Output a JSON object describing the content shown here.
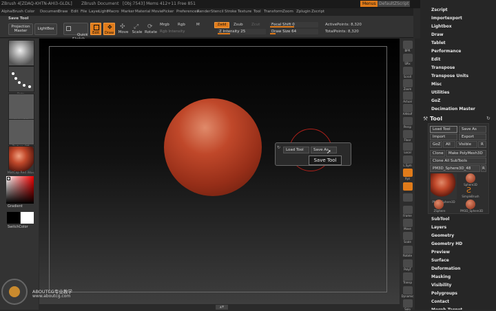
{
  "titlebar": {
    "app": "ZBrush 4[ZDAQ-KHTN-AHI3-GLDL]",
    "doc": "ZBrush Document",
    "stats": "[Obj:7543] Mems 412+11 Free 851",
    "menus_btn": "Menus",
    "script_btn": "DefaultZScript",
    "theme": "purpleicon"
  },
  "menubar": [
    "Alpha",
    "Brush",
    "Color",
    "Document",
    "Draw",
    "Edit",
    "File",
    "Layer",
    "Light",
    "Macro",
    "Marker",
    "Material",
    "Movie",
    "Picker",
    "Preferences",
    "Render",
    "Stencil",
    "Stroke",
    "Texture",
    "Tool",
    "Transform",
    "Zoom",
    "Zplugin",
    "Zscript"
  ],
  "toolbar": {
    "save_tool": "Save Tool",
    "projection_master": "Projection\nMaster",
    "lightbox": "LightBox",
    "quick_sketch": "Quick\nSketch",
    "edit": "Edit",
    "draw": "Draw",
    "move": "Move",
    "scale": "Scale",
    "rotate": "Rotate",
    "mrgb": "Mrgb",
    "rgb": "Rgb",
    "m": "M",
    "rgb_intensity": "Rgb Intensity",
    "zadd": "Zadd",
    "zsub": "Zsub",
    "zcut": "Zcut",
    "z_intensity": "Z Intensity 25",
    "focal_shift": "Focal Shift 0",
    "draw_size": "Draw Size 64",
    "active_points": "ActivePoints: 8,320",
    "total_points": "TotalPoints: 8,320"
  },
  "leftshelf": {
    "brush_cap": "Standard",
    "stroke_cap": "Dots",
    "alpha_cap": "Alpha Off",
    "texture_cap": "Texture Off",
    "material_cap": "MatCap Red Wax",
    "gradient": "Gradient",
    "switch_color": "SwitchColor"
  },
  "rightshelf": [
    "BPR",
    "SPix",
    "Scroll",
    "Zoom",
    "Actual",
    "AAHalf",
    "Persp",
    "Floor",
    "Local",
    "L.Sym",
    "Xyz",
    "",
    "",
    "Frame",
    "Move",
    "Scale",
    "Rotate",
    "PolyF",
    "Transp",
    "Dynamic",
    "Solo"
  ],
  "viewport_popup": {
    "load_tool": "Load Tool",
    "save_as": "Save As",
    "tooltip": "Save Tool"
  },
  "palette": {
    "top_items": [
      "Zscript",
      "Importexport",
      "Lightbox",
      "Draw",
      "Tablet",
      "Performance",
      "Edit",
      "Transpose",
      "Transpose Units",
      "Misc",
      "Utilities",
      "GoZ",
      "Decimation Master"
    ],
    "tool_title": "Tool",
    "load_tool": "Load Tool",
    "save_as": "Save As",
    "import": "Import",
    "export": "Export",
    "goz": "GoZ",
    "all": "All",
    "visible": "Visible",
    "r": "R",
    "clone": "Clone",
    "make_polymesh": "Make PolyMesh3D",
    "clone_all": "Clone All SubTools",
    "current_tool": "PM3D_Sphere3D_48",
    "tool_r": "R",
    "tools": [
      {
        "name": "PM3D_Sphere3D"
      },
      {
        "name": "Sphere3D"
      },
      {
        "name": "SimpleBrush"
      },
      {
        "name": "ZSphere"
      },
      {
        "name": "PM3D_Sphere3D"
      }
    ],
    "bottom_items": [
      "SubTool",
      "Layers",
      "Geometry",
      "Geometry HD",
      "Preview",
      "Surface",
      "Deformation",
      "Masking",
      "Visibility",
      "Polygroups",
      "Contact",
      "Morph Target"
    ]
  },
  "watermark": {
    "title": "ABOUTCG专业教学",
    "url": "www.aboutcg.com"
  },
  "colors": {
    "accent": "#e07b1a",
    "sphere": "#c0482a"
  }
}
